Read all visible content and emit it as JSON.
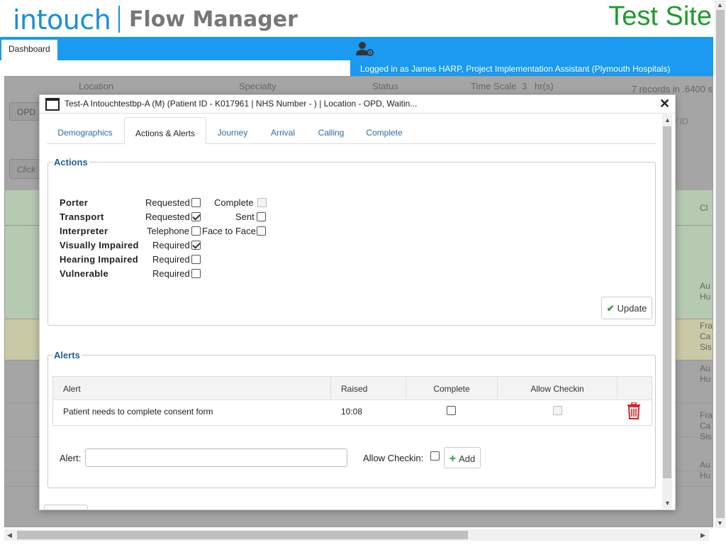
{
  "header": {
    "brand": "intouch",
    "product": "Flow Manager",
    "site_label": "Test Site",
    "nav_tab": "Dashboard",
    "logged_in": "Logged in as James HARP, Project Implementation Assistant (Plymouth Hospitals)"
  },
  "background": {
    "columns": [
      "Location",
      "Specialty",
      "Status"
    ],
    "time_scale_label": "Time Scale",
    "time_scale_value": "3",
    "time_scale_unit": "hr(s)",
    "records": "7 records in .6400 s",
    "filter_opd": "OPD",
    "filter_click": "Click",
    "id_placeholder": "/ ID",
    "col_ch": "Cl",
    "row_texts": [
      "Au\nHu",
      "Fra\nCa\nSis",
      "Au\nHu",
      "Fra\nCa\nSis",
      "Au\nHu"
    ],
    "row_colors": [
      "#b6c9b1",
      "#b6c9b1",
      "#c9c9a6",
      "#a5a5a5",
      "#a5a5a5",
      "#a5a5a5",
      "#a5a5a5"
    ]
  },
  "modal": {
    "title": "Test-A Intouchtestbp-A (M) (Patient ID - K017961 | NHS Number - ) | Location - OPD, Waitin...",
    "tabs": [
      "Demographics",
      "Actions & Alerts",
      "Journey",
      "Arrival",
      "Calling",
      "Complete"
    ],
    "active_tab": 1,
    "actions": {
      "legend": "Actions",
      "rows": [
        {
          "label": "Porter",
          "opt1": "Requested",
          "opt1_checked": false,
          "opt2": "Complete",
          "opt2_checked": false,
          "opt2_disabled": true
        },
        {
          "label": "Transport",
          "opt1": "Requested",
          "opt1_checked": true,
          "opt2": "Sent",
          "opt2_checked": false,
          "opt2_disabled": false
        },
        {
          "label": "Interpreter",
          "opt1": "Telephone",
          "opt1_checked": false,
          "opt2": "Face to Face",
          "opt2_checked": false,
          "opt2_disabled": false
        },
        {
          "label": "Visually Impaired",
          "opt1": "Required",
          "opt1_checked": true
        },
        {
          "label": "Hearing Impaired",
          "opt1": "Required",
          "opt1_checked": false
        },
        {
          "label": "Vulnerable",
          "opt1": "Required",
          "opt1_checked": false
        }
      ],
      "update_label": "Update"
    },
    "alerts": {
      "legend": "Alerts",
      "headers": [
        "Alert",
        "Raised",
        "Complete",
        "Allow Checkin"
      ],
      "rows": [
        {
          "alert": "Patient needs to complete consent form",
          "raised": "10:08",
          "complete": false,
          "allow_checkin": false
        }
      ],
      "alert_label": "Alert:",
      "alert_value": "",
      "allow_checkin_label": "Allow Checkin:",
      "add_label": "Add"
    }
  }
}
